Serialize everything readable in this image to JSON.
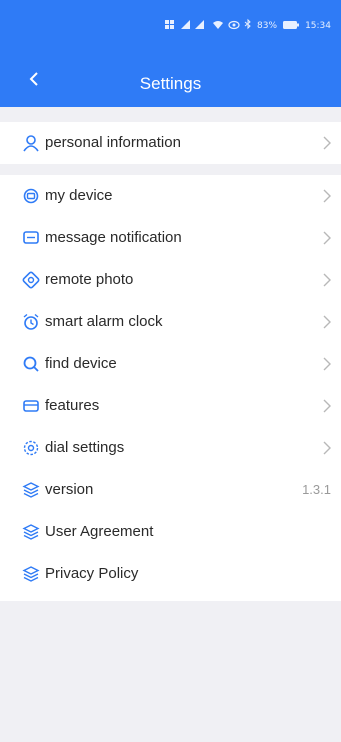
{
  "status_bar": {
    "battery": "83%",
    "time": "15:34"
  },
  "header": {
    "title": "Settings"
  },
  "section1": [
    {
      "label": "personal information",
      "icon": "person-icon"
    }
  ],
  "section2": [
    {
      "label": "my device",
      "icon": "device-icon"
    },
    {
      "label": "message notification",
      "icon": "message-icon"
    },
    {
      "label": "remote photo",
      "icon": "camera-icon"
    },
    {
      "label": "smart alarm clock",
      "icon": "alarm-clock-icon"
    },
    {
      "label": "find device",
      "icon": "search-icon"
    },
    {
      "label": "features",
      "icon": "features-icon"
    },
    {
      "label": "dial settings",
      "icon": "gear-icon"
    },
    {
      "label": "version",
      "icon": "layers-icon",
      "value": "1.3.1"
    },
    {
      "label": "User Agreement",
      "icon": "layers-icon"
    },
    {
      "label": "Privacy Policy",
      "icon": "layers-icon"
    }
  ],
  "colors": {
    "accent": "#2f7bf6",
    "background": "#f0f0f4",
    "text": "#2a2a2a",
    "muted": "#9a9a9a"
  }
}
